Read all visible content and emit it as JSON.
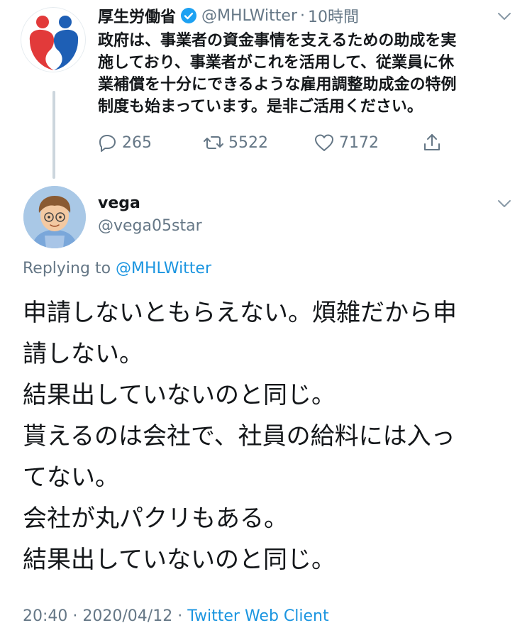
{
  "parent_tweet": {
    "display_name": "厚生労働省",
    "handle": "@MHLWitter",
    "separator": "·",
    "time_ago": "10時間",
    "text_lines": [
      "政府は、事業者の資金事情を支えるための助成を実",
      "施しており、事業者がこれを活用して、従業員に休",
      "業補償を十分にできるような雇用調整助成金の特例",
      "制度も始まっています。是非ご活用ください。"
    ],
    "actions": {
      "reply_count": "265",
      "retweet_count": "5522",
      "like_count": "7172"
    },
    "icons": [
      "verified-badge-icon",
      "chevron-down-icon",
      "reply-icon",
      "retweet-icon",
      "like-icon",
      "share-icon"
    ]
  },
  "reply_tweet": {
    "display_name": "vega",
    "handle": "@vega05star",
    "replying_prefix": "Replying to",
    "replying_handle": "@MHLWitter",
    "body_lines": [
      "申請しないともらえない。煩雑だから申",
      "請しない。",
      "結果出していないのと同じ。",
      "貰えるのは会社で、社員の給料には入っ",
      "てない。",
      "会社が丸パクリもある。",
      "結果出していないのと同じ。"
    ],
    "time": "20:40",
    "dot": "·",
    "date": "2020/04/12",
    "client": "Twitter Web Client"
  },
  "colors": {
    "text": "#14171a",
    "secondary": "#657786",
    "link": "#1b95e0",
    "verified": "#1da1f2",
    "thread_line": "#ccd6dd"
  }
}
